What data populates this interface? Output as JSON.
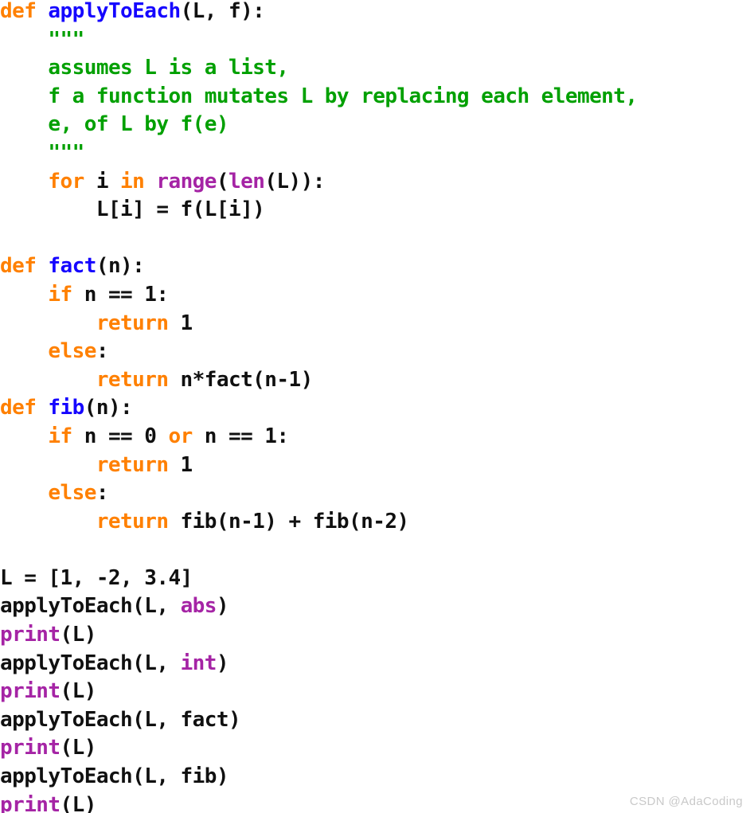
{
  "meta": {
    "background_color": "#ffffff",
    "language": "python"
  },
  "theme": {
    "keyword_color": "#ff8000",
    "function_name_color": "#1505ff",
    "builtin_color": "#a524a5",
    "string_color": "#00a000",
    "plain_color": "#101010",
    "watermark_color": "#c9c9c9"
  },
  "watermark": {
    "text": "CSDN @AdaCoding"
  },
  "code": {
    "lines": [
      {
        "index": 1,
        "tokens": [
          {
            "t": "def ",
            "c": "kw"
          },
          {
            "t": "applyToEach",
            "c": "fname"
          },
          {
            "t": "(L, f):",
            "c": "plain"
          }
        ]
      },
      {
        "index": 2,
        "tokens": [
          {
            "t": "    ",
            "c": "plain"
          },
          {
            "t": "\"\"\"",
            "c": "str"
          }
        ]
      },
      {
        "index": 3,
        "tokens": [
          {
            "t": "    ",
            "c": "plain"
          },
          {
            "t": "assumes L is a list,",
            "c": "str"
          }
        ]
      },
      {
        "index": 4,
        "tokens": [
          {
            "t": "    ",
            "c": "plain"
          },
          {
            "t": "f a function mutates L by replacing each element,",
            "c": "str"
          }
        ]
      },
      {
        "index": 5,
        "tokens": [
          {
            "t": "    ",
            "c": "plain"
          },
          {
            "t": "e, of L by f(e)",
            "c": "str"
          }
        ]
      },
      {
        "index": 6,
        "tokens": [
          {
            "t": "    ",
            "c": "plain"
          },
          {
            "t": "\"\"\"",
            "c": "str"
          }
        ]
      },
      {
        "index": 7,
        "tokens": [
          {
            "t": "    ",
            "c": "plain"
          },
          {
            "t": "for",
            "c": "kw"
          },
          {
            "t": " i ",
            "c": "plain"
          },
          {
            "t": "in",
            "c": "kw"
          },
          {
            "t": " ",
            "c": "plain"
          },
          {
            "t": "range",
            "c": "builtin"
          },
          {
            "t": "(",
            "c": "plain"
          },
          {
            "t": "len",
            "c": "builtin"
          },
          {
            "t": "(L)):",
            "c": "plain"
          }
        ]
      },
      {
        "index": 8,
        "tokens": [
          {
            "t": "        L[i] = f(L[i])",
            "c": "plain"
          }
        ]
      },
      {
        "index": 9,
        "tokens": [
          {
            "t": "",
            "c": "plain"
          }
        ]
      },
      {
        "index": 10,
        "tokens": [
          {
            "t": "def ",
            "c": "kw"
          },
          {
            "t": "fact",
            "c": "fname"
          },
          {
            "t": "(n):",
            "c": "plain"
          }
        ]
      },
      {
        "index": 11,
        "tokens": [
          {
            "t": "    ",
            "c": "plain"
          },
          {
            "t": "if",
            "c": "kw"
          },
          {
            "t": " n == 1:",
            "c": "plain"
          }
        ]
      },
      {
        "index": 12,
        "tokens": [
          {
            "t": "        ",
            "c": "plain"
          },
          {
            "t": "return",
            "c": "kw"
          },
          {
            "t": " 1",
            "c": "plain"
          }
        ]
      },
      {
        "index": 13,
        "tokens": [
          {
            "t": "    ",
            "c": "plain"
          },
          {
            "t": "else",
            "c": "kw"
          },
          {
            "t": ":",
            "c": "plain"
          }
        ]
      },
      {
        "index": 14,
        "tokens": [
          {
            "t": "        ",
            "c": "plain"
          },
          {
            "t": "return",
            "c": "kw"
          },
          {
            "t": " n*fact(n-1)",
            "c": "plain"
          }
        ]
      },
      {
        "index": 15,
        "tokens": [
          {
            "t": "def ",
            "c": "kw"
          },
          {
            "t": "fib",
            "c": "fname"
          },
          {
            "t": "(n):",
            "c": "plain"
          }
        ]
      },
      {
        "index": 16,
        "tokens": [
          {
            "t": "    ",
            "c": "plain"
          },
          {
            "t": "if",
            "c": "kw"
          },
          {
            "t": " n == 0 ",
            "c": "plain"
          },
          {
            "t": "or",
            "c": "kw"
          },
          {
            "t": " n == 1:",
            "c": "plain"
          }
        ]
      },
      {
        "index": 17,
        "tokens": [
          {
            "t": "        ",
            "c": "plain"
          },
          {
            "t": "return",
            "c": "kw"
          },
          {
            "t": " 1",
            "c": "plain"
          }
        ]
      },
      {
        "index": 18,
        "tokens": [
          {
            "t": "    ",
            "c": "plain"
          },
          {
            "t": "else",
            "c": "kw"
          },
          {
            "t": ":",
            "c": "plain"
          }
        ]
      },
      {
        "index": 19,
        "tokens": [
          {
            "t": "        ",
            "c": "plain"
          },
          {
            "t": "return",
            "c": "kw"
          },
          {
            "t": " fib(n-1) + fib(n-2)",
            "c": "plain"
          }
        ]
      },
      {
        "index": 20,
        "tokens": [
          {
            "t": "",
            "c": "plain"
          }
        ]
      },
      {
        "index": 21,
        "tokens": [
          {
            "t": "L = [1, -2, 3.4]",
            "c": "plain"
          }
        ]
      },
      {
        "index": 22,
        "tokens": [
          {
            "t": "applyToEach(L, ",
            "c": "plain"
          },
          {
            "t": "abs",
            "c": "builtin"
          },
          {
            "t": ")",
            "c": "plain"
          }
        ]
      },
      {
        "index": 23,
        "tokens": [
          {
            "t": "print",
            "c": "builtin"
          },
          {
            "t": "(L)",
            "c": "plain"
          }
        ]
      },
      {
        "index": 24,
        "tokens": [
          {
            "t": "applyToEach(L, ",
            "c": "plain"
          },
          {
            "t": "int",
            "c": "builtin"
          },
          {
            "t": ")",
            "c": "plain"
          }
        ]
      },
      {
        "index": 25,
        "tokens": [
          {
            "t": "print",
            "c": "builtin"
          },
          {
            "t": "(L)",
            "c": "plain"
          }
        ]
      },
      {
        "index": 26,
        "tokens": [
          {
            "t": "applyToEach(L, fact)",
            "c": "plain"
          }
        ]
      },
      {
        "index": 27,
        "tokens": [
          {
            "t": "print",
            "c": "builtin"
          },
          {
            "t": "(L)",
            "c": "plain"
          }
        ]
      },
      {
        "index": 28,
        "tokens": [
          {
            "t": "applyToEach(L, fib)",
            "c": "plain"
          }
        ]
      },
      {
        "index": 29,
        "tokens": [
          {
            "t": "print",
            "c": "builtin"
          },
          {
            "t": "(L)",
            "c": "plain"
          }
        ]
      }
    ]
  }
}
